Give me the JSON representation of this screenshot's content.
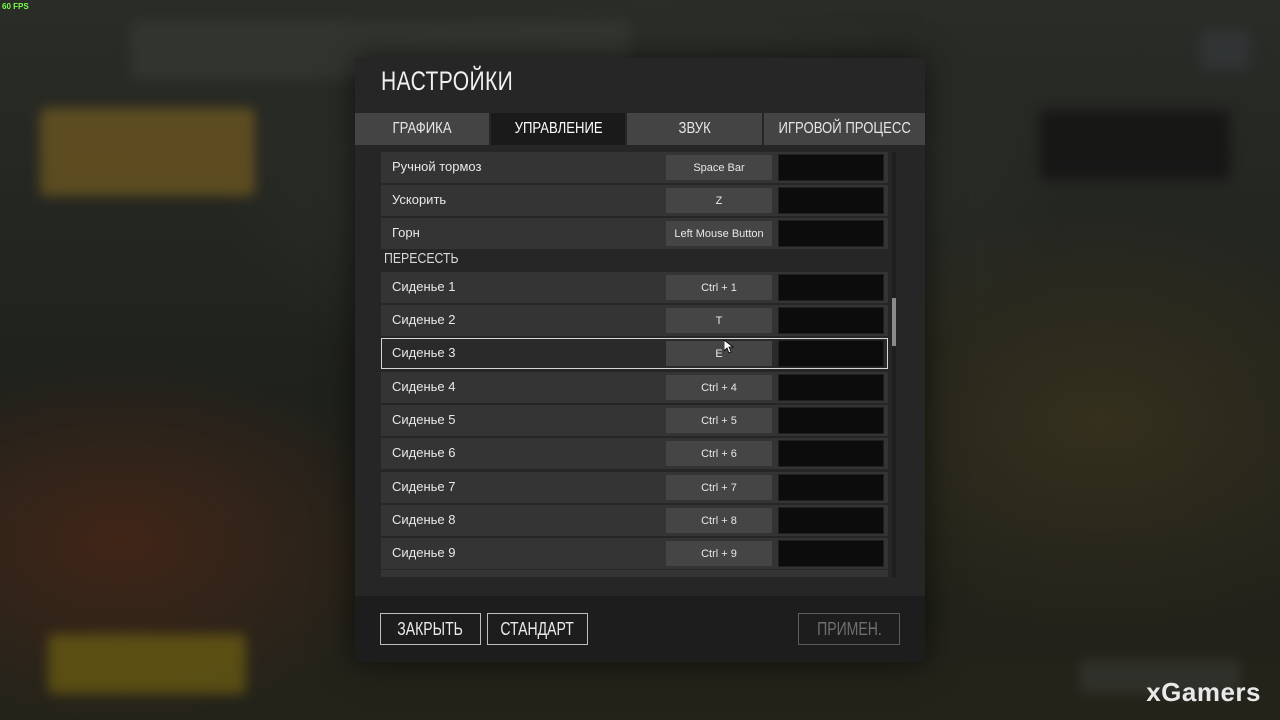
{
  "overlay": {
    "fps": "60 FPS",
    "watermark": "xGamers"
  },
  "dialog": {
    "title": "НАСТРОЙКИ",
    "tabs": [
      {
        "label": "ГРАФИКА",
        "active": false
      },
      {
        "label": "УПРАВЛЕНИЕ",
        "active": true
      },
      {
        "label": "ЗВУК",
        "active": false
      },
      {
        "label": "ИГРОВОЙ ПРОЦЕСС",
        "active": false
      }
    ],
    "vehicle_rows": [
      {
        "action": "Ручной тормоз",
        "key1": "Space Bar",
        "key2": ""
      },
      {
        "action": "Ускорить",
        "key1": "Z",
        "key2": ""
      },
      {
        "action": "Горн",
        "key1": "Left Mouse Button",
        "key2": ""
      }
    ],
    "section_title": "ПЕРЕСЕСТЬ",
    "seat_rows": [
      {
        "action": "Сиденье 1",
        "key1": "Ctrl + 1",
        "key2": ""
      },
      {
        "action": "Сиденье 2",
        "key1": "T",
        "key2": ""
      },
      {
        "action": "Сиденье 3",
        "key1": "E",
        "key2": "",
        "selected": true
      },
      {
        "action": "Сиденье 4",
        "key1": "Ctrl + 4",
        "key2": ""
      },
      {
        "action": "Сиденье 5",
        "key1": "Ctrl + 5",
        "key2": ""
      },
      {
        "action": "Сиденье 6",
        "key1": "Ctrl + 6",
        "key2": ""
      },
      {
        "action": "Сиденье 7",
        "key1": "Ctrl + 7",
        "key2": ""
      },
      {
        "action": "Сиденье 8",
        "key1": "Ctrl + 8",
        "key2": ""
      },
      {
        "action": "Сиденье 9",
        "key1": "Ctrl + 9",
        "key2": ""
      }
    ],
    "buttons": {
      "close": "ЗАКРЫТЬ",
      "default": "СТАНДАРТ",
      "apply": "ПРИМЕН."
    }
  },
  "colors": {
    "panel": "#262626",
    "row": "#343434",
    "active_tab": "#1a1a1a",
    "fps_green": "#7cff4a"
  },
  "icons": {
    "cursor": "mouse-pointer-icon"
  }
}
